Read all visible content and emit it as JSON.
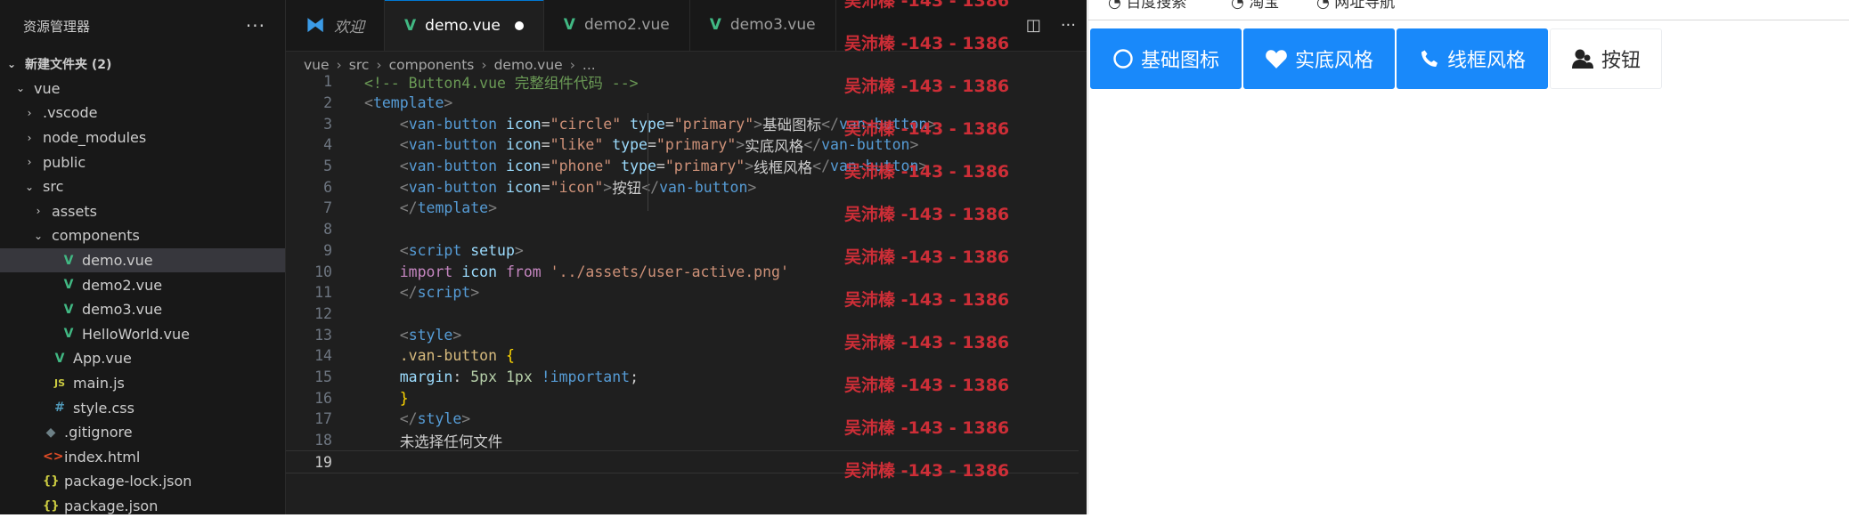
{
  "explorer": {
    "title": "资源管理器",
    "more": "···",
    "items": [
      {
        "label": "新建文件夹 (2)",
        "chev": "⌄",
        "icon": "",
        "level": 0,
        "kind": "folder-root"
      },
      {
        "label": "vue",
        "chev": "⌄",
        "icon": "",
        "level": 1,
        "kind": "folder"
      },
      {
        "label": ".vscode",
        "chev": "›",
        "icon": "",
        "level": 2,
        "kind": "folder"
      },
      {
        "label": "node_modules",
        "chev": "›",
        "icon": "",
        "level": 2,
        "kind": "folder"
      },
      {
        "label": "public",
        "chev": "›",
        "icon": "",
        "level": 2,
        "kind": "folder"
      },
      {
        "label": "src",
        "chev": "⌄",
        "icon": "",
        "level": 2,
        "kind": "folder"
      },
      {
        "label": "assets",
        "chev": "›",
        "icon": "",
        "level": 3,
        "kind": "folder"
      },
      {
        "label": "components",
        "chev": "⌄",
        "icon": "",
        "level": 3,
        "kind": "folder"
      },
      {
        "label": "demo.vue",
        "chev": "",
        "icon": "V",
        "level": 4,
        "kind": "vue",
        "selected": true
      },
      {
        "label": "demo2.vue",
        "chev": "",
        "icon": "V",
        "level": 4,
        "kind": "vue"
      },
      {
        "label": "demo3.vue",
        "chev": "",
        "icon": "V",
        "level": 4,
        "kind": "vue"
      },
      {
        "label": "HelloWorld.vue",
        "chev": "",
        "icon": "V",
        "level": 4,
        "kind": "vue"
      },
      {
        "label": "App.vue",
        "chev": "",
        "icon": "V",
        "level": 3,
        "kind": "vue"
      },
      {
        "label": "main.js",
        "chev": "",
        "icon": "JS",
        "level": 3,
        "kind": "js"
      },
      {
        "label": "style.css",
        "chev": "",
        "icon": "#",
        "level": 3,
        "kind": "css"
      },
      {
        "label": ".gitignore",
        "chev": "",
        "icon": "◆",
        "level": 2,
        "kind": "git"
      },
      {
        "label": "index.html",
        "chev": "",
        "icon": "<>",
        "level": 2,
        "kind": "html"
      },
      {
        "label": "package-lock.json",
        "chev": "",
        "icon": "{}",
        "level": 2,
        "kind": "json"
      },
      {
        "label": "package.json",
        "chev": "",
        "icon": "{}",
        "level": 2,
        "kind": "json"
      }
    ]
  },
  "tabs": [
    {
      "label": "欢迎",
      "icon": "vscode-icon",
      "italic": true
    },
    {
      "label": "demo.vue",
      "icon": "vue-icon",
      "active": true,
      "dirty": true
    },
    {
      "label": "demo2.vue",
      "icon": "vue-icon"
    },
    {
      "label": "demo3.vue",
      "icon": "vue-icon"
    }
  ],
  "breadcrumb": [
    "vue",
    "src",
    "components",
    "demo.vue",
    "..."
  ],
  "code": [
    {
      "n": "1",
      "tokens": [
        [
          "cm",
          "<!-- Button4.vue 完整组件代码 -->"
        ]
      ]
    },
    {
      "n": "2",
      "tokens": [
        [
          "br",
          "<"
        ],
        [
          "tag",
          "template"
        ],
        [
          "br",
          ">"
        ]
      ]
    },
    {
      "n": "3",
      "tokens": [
        [
          "txt",
          "    "
        ],
        [
          "br",
          "<"
        ],
        [
          "tag",
          "van-button"
        ],
        [
          "txt",
          " "
        ],
        [
          "at",
          "icon"
        ],
        [
          "txt",
          "="
        ],
        [
          "st",
          "\"circle\""
        ],
        [
          "txt",
          " "
        ],
        [
          "at",
          "type"
        ],
        [
          "txt",
          "="
        ],
        [
          "st",
          "\"primary\""
        ],
        [
          "br",
          ">"
        ],
        [
          "txt",
          "基础图标"
        ],
        [
          "br",
          "</"
        ],
        [
          "tag",
          "van-button"
        ],
        [
          "br",
          ">"
        ]
      ]
    },
    {
      "n": "4",
      "tokens": [
        [
          "txt",
          "    "
        ],
        [
          "br",
          "<"
        ],
        [
          "tag",
          "van-button"
        ],
        [
          "txt",
          " "
        ],
        [
          "at",
          "icon"
        ],
        [
          "txt",
          "="
        ],
        [
          "st",
          "\"like\""
        ],
        [
          "txt",
          " "
        ],
        [
          "at",
          "type"
        ],
        [
          "txt",
          "="
        ],
        [
          "st",
          "\"primary\""
        ],
        [
          "br",
          ">"
        ],
        [
          "txt",
          "实底风格"
        ],
        [
          "br",
          "</"
        ],
        [
          "tag",
          "van-button"
        ],
        [
          "br",
          ">"
        ]
      ]
    },
    {
      "n": "5",
      "tokens": [
        [
          "txt",
          "    "
        ],
        [
          "br",
          "<"
        ],
        [
          "tag",
          "van-button"
        ],
        [
          "txt",
          " "
        ],
        [
          "at",
          "icon"
        ],
        [
          "txt",
          "="
        ],
        [
          "st",
          "\"phone\""
        ],
        [
          "txt",
          " "
        ],
        [
          "at",
          "type"
        ],
        [
          "txt",
          "="
        ],
        [
          "st",
          "\"primary\""
        ],
        [
          "br",
          ">"
        ],
        [
          "txt",
          "线框风格"
        ],
        [
          "br",
          "</"
        ],
        [
          "tag",
          "van-button"
        ],
        [
          "br",
          ">"
        ]
      ]
    },
    {
      "n": "6",
      "tokens": [
        [
          "txt",
          "    "
        ],
        [
          "br",
          "<"
        ],
        [
          "tag",
          "van-button"
        ],
        [
          "txt",
          " "
        ],
        [
          "at",
          "icon"
        ],
        [
          "txt",
          "="
        ],
        [
          "st",
          "\"icon\""
        ],
        [
          "br",
          ">"
        ],
        [
          "txt",
          "按钮"
        ],
        [
          "br",
          "</"
        ],
        [
          "tag",
          "van-button"
        ],
        [
          "br",
          ">"
        ]
      ]
    },
    {
      "n": "7",
      "tokens": [
        [
          "txt",
          "    "
        ],
        [
          "br",
          "</"
        ],
        [
          "tag",
          "template"
        ],
        [
          "br",
          ">"
        ]
      ]
    },
    {
      "n": "8",
      "tokens": []
    },
    {
      "n": "9",
      "tokens": [
        [
          "txt",
          "    "
        ],
        [
          "br",
          "<"
        ],
        [
          "tag",
          "script"
        ],
        [
          "txt",
          " "
        ],
        [
          "at",
          "setup"
        ],
        [
          "br",
          ">"
        ]
      ]
    },
    {
      "n": "10",
      "tokens": [
        [
          "txt",
          "    "
        ],
        [
          "kw",
          "import"
        ],
        [
          "txt",
          " "
        ],
        [
          "at",
          "icon"
        ],
        [
          "txt",
          " "
        ],
        [
          "kw",
          "from"
        ],
        [
          "txt",
          " "
        ],
        [
          "st",
          "'../assets/user-active.png'"
        ]
      ]
    },
    {
      "n": "11",
      "tokens": [
        [
          "txt",
          "    "
        ],
        [
          "br",
          "</"
        ],
        [
          "tag",
          "script"
        ],
        [
          "br",
          ">"
        ]
      ]
    },
    {
      "n": "12",
      "tokens": []
    },
    {
      "n": "13",
      "tokens": [
        [
          "txt",
          "    "
        ],
        [
          "br",
          "<"
        ],
        [
          "tag",
          "style"
        ],
        [
          "br",
          ">"
        ]
      ]
    },
    {
      "n": "14",
      "tokens": [
        [
          "txt",
          "    "
        ],
        [
          "sel",
          ".van-button"
        ],
        [
          "txt",
          " "
        ],
        [
          "pun",
          "{"
        ]
      ]
    },
    {
      "n": "15",
      "tokens": [
        [
          "txt",
          "    "
        ],
        [
          "at",
          "margin"
        ],
        [
          "txt",
          ": "
        ],
        [
          "num",
          "5px"
        ],
        [
          "txt",
          " "
        ],
        [
          "num",
          "1px"
        ],
        [
          "txt",
          " "
        ],
        [
          "tag",
          "!important"
        ],
        [
          "txt",
          ";"
        ]
      ]
    },
    {
      "n": "16",
      "tokens": [
        [
          "txt",
          "    "
        ],
        [
          "pun",
          "}"
        ]
      ]
    },
    {
      "n": "17",
      "tokens": [
        [
          "txt",
          "    "
        ],
        [
          "br",
          "</"
        ],
        [
          "tag",
          "style"
        ],
        [
          "br",
          ">"
        ]
      ]
    },
    {
      "n": "18",
      "tokens": [
        [
          "txt",
          "    未选择任何文件"
        ]
      ]
    },
    {
      "n": "19",
      "tokens": [],
      "current": true
    }
  ],
  "watermark_text": "吴沛榛 -143 - 1386",
  "preview": {
    "top_links": [
      "百度搜索",
      "淘宝",
      "网址导航"
    ],
    "buttons": [
      {
        "label": "基础图标",
        "icon": "circle-icon",
        "style": "primary"
      },
      {
        "label": "实底风格",
        "icon": "heart-icon",
        "style": "primary"
      },
      {
        "label": "线框风格",
        "icon": "phone-icon",
        "style": "primary"
      },
      {
        "label": "按钮",
        "icon": "user-icon",
        "style": "default"
      }
    ]
  },
  "colors": {
    "accent": "#1989fa",
    "editor_bg": "#1f1f1f",
    "sidebar_bg": "#181818",
    "watermark": "#e0303a"
  }
}
